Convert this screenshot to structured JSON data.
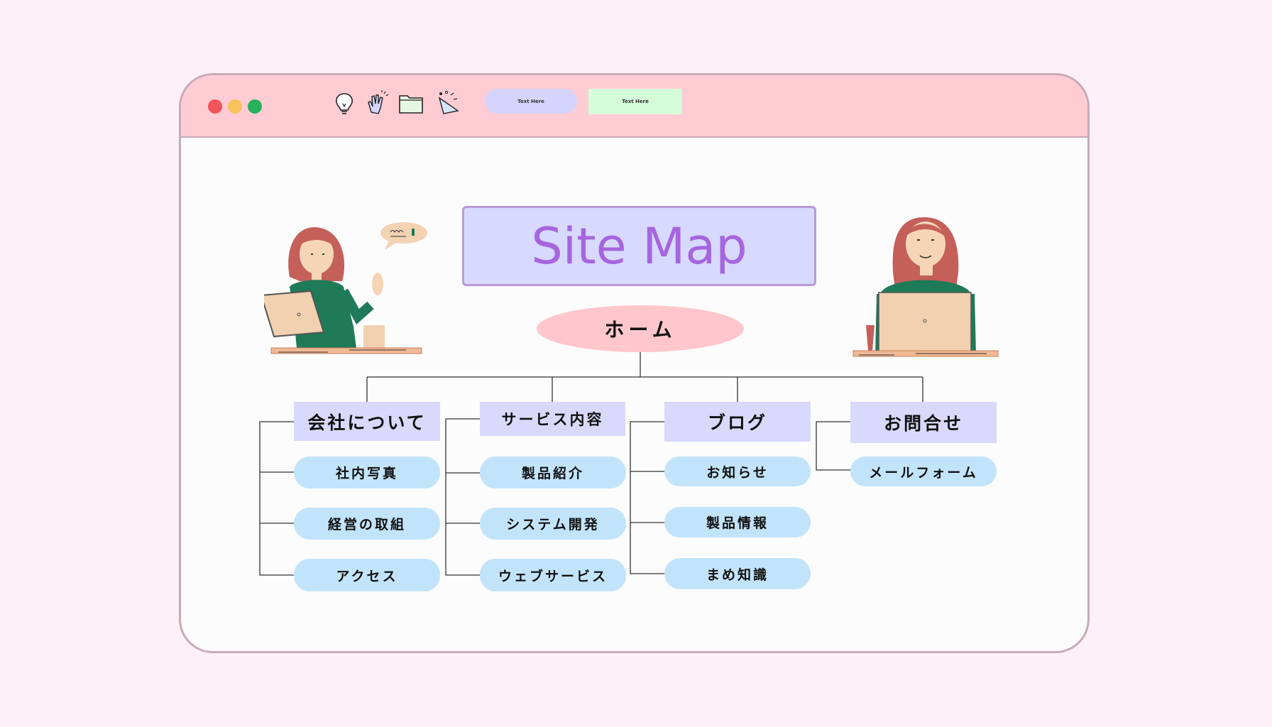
{
  "window": {
    "traffic_lights": {
      "red": "#f2545b",
      "yellow": "#f7c35a",
      "green": "#26b15a"
    },
    "toolbar_icons": [
      "lightbulb-icon",
      "clap-hands-icon",
      "folder-icon",
      "party-popper-icon"
    ],
    "pill_1_label": "Text Here",
    "pill_2_label": "Text Here",
    "pill_1_color": "#d5d4fc",
    "pill_2_color": "#d4fcd9"
  },
  "sitemap": {
    "title": "Site Map",
    "home": "ホーム",
    "categories": [
      {
        "label": "会社について",
        "children": [
          "社内写真",
          "経営の取組",
          "アクセス"
        ]
      },
      {
        "label": "サービス内容",
        "children": [
          "製品紹介",
          "システム開発",
          "ウェブサービス"
        ]
      },
      {
        "label": "ブログ",
        "children": [
          "お知らせ",
          "製品情報",
          "まめ知識"
        ]
      },
      {
        "label": "お問合せ",
        "children": [
          "メールフォーム"
        ]
      }
    ]
  },
  "colors": {
    "background": "#fdf0f6",
    "titlebar": "#ffccd3",
    "title_box": "#d7d9ff",
    "title_text": "#a665de",
    "home_ellipse": "#ffc7cd",
    "category_box": "#d9d9fc",
    "child_pill": "#c2e4fb"
  }
}
